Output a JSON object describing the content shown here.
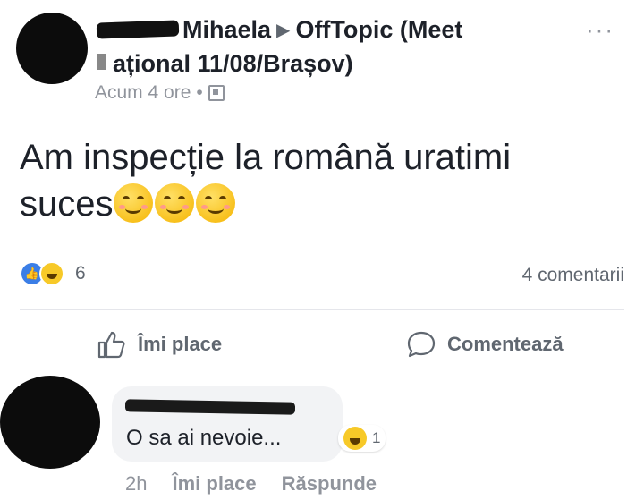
{
  "post": {
    "author_visible": "Mihaela",
    "group_line1": "OffTopic (Meet",
    "group_line2": "ațional 11/08/Brașov)",
    "timestamp": "Acum 4 ore",
    "audience_icon": "group-icon",
    "text_line1": "Am inspecție  la română  uratimi",
    "text_line2": "suces",
    "emoji_count": 3,
    "more_icon": "···"
  },
  "reactions": {
    "types": [
      "like",
      "haha"
    ],
    "count": "6",
    "comments_label": "4 comentarii"
  },
  "actions": {
    "like_label": "Îmi place",
    "comment_label": "Comentează"
  },
  "comment": {
    "text": "O sa ai nevoie...",
    "reaction_count": "1",
    "time": "2h",
    "like_label": "Îmi place",
    "reply_label": "Răspunde"
  },
  "colors": {
    "like_blue": "#3b7ee6",
    "haha_yellow": "#f7c928",
    "muted_text": "#90949c"
  }
}
